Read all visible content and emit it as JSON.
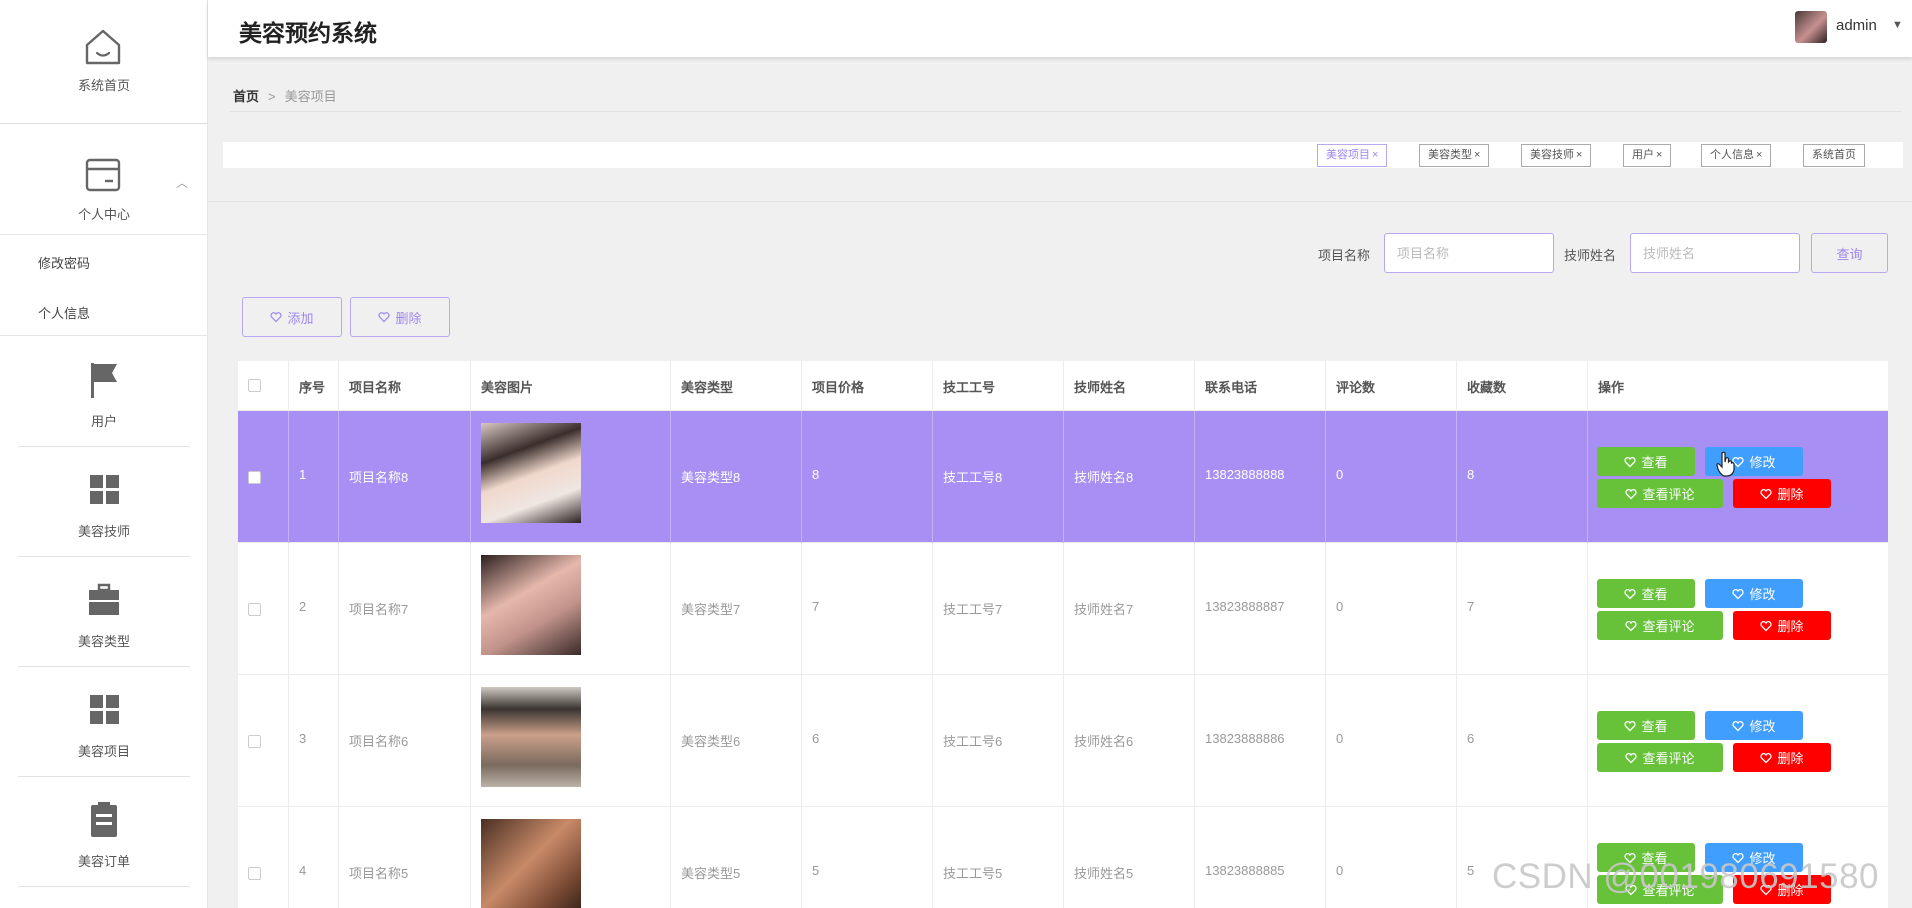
{
  "header": {
    "title": "美容预约系统",
    "user": "admin"
  },
  "sidebar": {
    "home_label": "系统首页",
    "personal_center": "个人中心",
    "sub_items": [
      "修改密码",
      "个人信息"
    ],
    "items": [
      {
        "label": "用户",
        "icon": "flag-icon"
      },
      {
        "label": "美容技师",
        "icon": "grid-icon"
      },
      {
        "label": "美容类型",
        "icon": "briefcase-icon"
      },
      {
        "label": "美容项目",
        "icon": "grid-icon"
      },
      {
        "label": "美容订单",
        "icon": "clipboard-icon"
      }
    ]
  },
  "breadcrumb": {
    "home": "首页",
    "sep": ">",
    "current": "美容项目"
  },
  "tags": [
    {
      "label": "美容项目",
      "close": "×",
      "active": true
    },
    {
      "label": "美容类型",
      "close": "×",
      "active": false
    },
    {
      "label": "美容技师",
      "close": "×",
      "active": false
    },
    {
      "label": "用户",
      "close": "×",
      "active": false
    },
    {
      "label": "个人信息",
      "close": "×",
      "active": false
    },
    {
      "label": "系统首页",
      "close": "",
      "active": false
    }
  ],
  "search": {
    "project_label": "项目名称",
    "project_placeholder": "项目名称",
    "tech_label": "技师姓名",
    "tech_placeholder": "技师姓名",
    "query_button": "查询"
  },
  "toolbar": {
    "add": "添加",
    "delete": "删除"
  },
  "table": {
    "headers": [
      "序号",
      "项目名称",
      "美容图片",
      "美容类型",
      "项目价格",
      "技工工号",
      "技师姓名",
      "联系电话",
      "评论数",
      "收藏数",
      "操作"
    ],
    "rows": [
      {
        "idx": "1",
        "name": "项目名称8",
        "type": "美容类型8",
        "price": "8",
        "worker_no": "技工工号8",
        "tech": "技师姓名8",
        "phone": "13823888888",
        "comments": "0",
        "favorites": "8",
        "highlight": true
      },
      {
        "idx": "2",
        "name": "项目名称7",
        "type": "美容类型7",
        "price": "7",
        "worker_no": "技工工号7",
        "tech": "技师姓名7",
        "phone": "13823888887",
        "comments": "0",
        "favorites": "7",
        "highlight": false
      },
      {
        "idx": "3",
        "name": "项目名称6",
        "type": "美容类型6",
        "price": "6",
        "worker_no": "技工工号6",
        "tech": "技师姓名6",
        "phone": "13823888886",
        "comments": "0",
        "favorites": "6",
        "highlight": false
      },
      {
        "idx": "4",
        "name": "项目名称5",
        "type": "美容类型5",
        "price": "5",
        "worker_no": "技工工号5",
        "tech": "技师姓名5",
        "phone": "13823888885",
        "comments": "0",
        "favorites": "5",
        "highlight": false
      }
    ],
    "actions": {
      "view": "查看",
      "edit": "修改",
      "view_comments": "查看评论",
      "delete": "删除"
    }
  },
  "colors": {
    "accent": "#a78ff3",
    "green": "#67c23a",
    "blue": "#409eff",
    "red": "#ff0000"
  },
  "watermark": "CSDN @001980691580"
}
